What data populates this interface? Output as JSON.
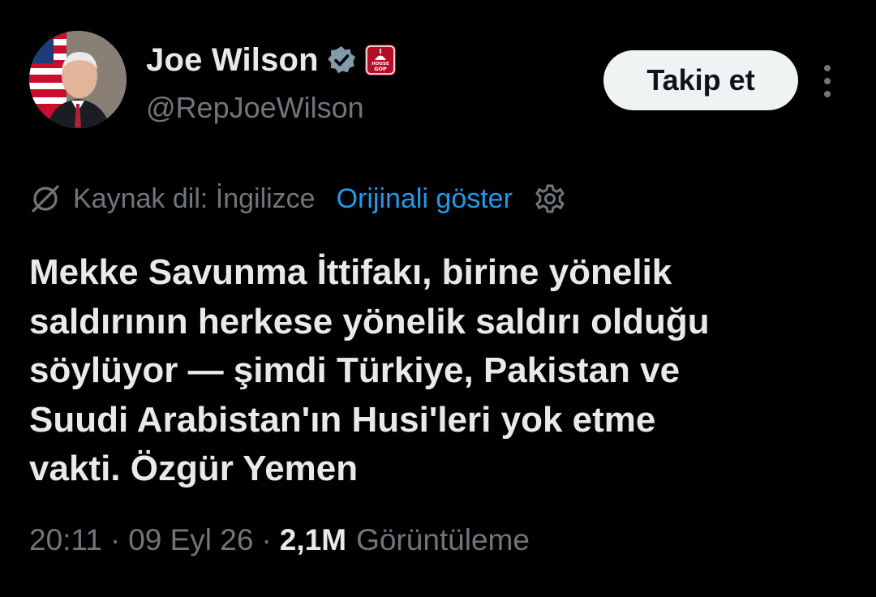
{
  "author": {
    "name": "Joe Wilson",
    "handle": "@RepJoeWilson",
    "affiliation_badge_text": [
      "HOUSE",
      "GOP"
    ]
  },
  "actions": {
    "follow_label": "Takip et"
  },
  "translation": {
    "source_language": "Kaynak dil: İngilizce",
    "show_original": "Orijinali göster"
  },
  "tweet": {
    "text": "Mekke Savunma İttifakı, birine yönelik\nsaldırının herkese yönelik saldırı olduğu\nsöylüyor — şimdi Türkiye, Pakistan ve\nSuudi Arabistan'ın Husi'leri yok etme\nvakti. Özgür Yemen"
  },
  "meta": {
    "time": "20:11",
    "date": "09 Eyl 26",
    "separator": "·",
    "views_count": "2,1M",
    "views_label": "Görüntüleme"
  },
  "colors": {
    "background": "#000000",
    "text_primary": "#e7e9ea",
    "text_secondary": "#71767b",
    "link_blue": "#1d9bf0",
    "verified_gray": "#829aab",
    "badge_red": "#c8102e"
  },
  "icons": {
    "verified": "verified-badge-icon",
    "affiliation": "house-gop-logo-icon",
    "more": "more-vertical-icon",
    "translate": "translate-slash-icon",
    "settings": "gear-icon"
  }
}
